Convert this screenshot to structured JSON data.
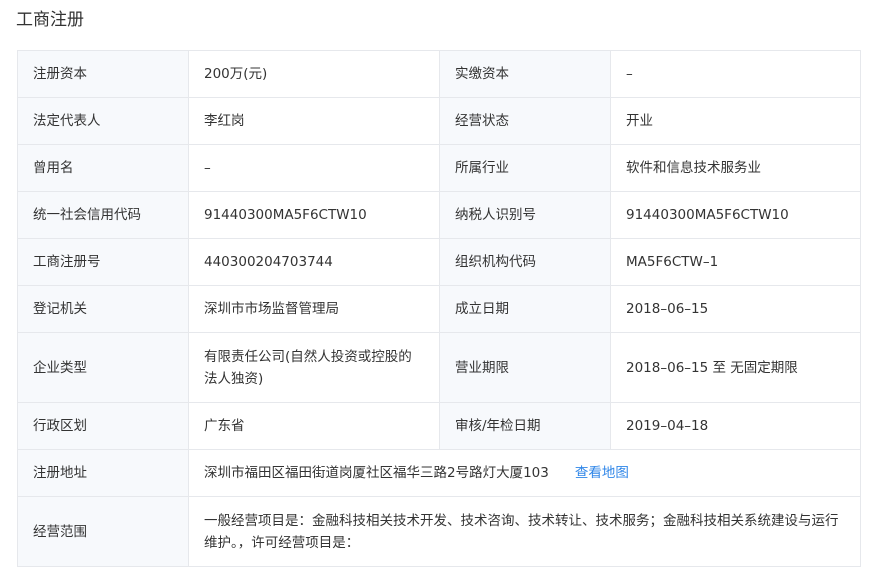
{
  "section": {
    "title": "工商注册"
  },
  "rows": [
    {
      "l1": "注册资本",
      "v1": "200万(元)",
      "l2": "实缴资本",
      "v2": "–"
    },
    {
      "l1": "法定代表人",
      "v1": "李红岗",
      "l2": "经营状态",
      "v2": "开业"
    },
    {
      "l1": "曾用名",
      "v1": "–",
      "l2": "所属行业",
      "v2": "软件和信息技术服务业"
    },
    {
      "l1": "统一社会信用代码",
      "v1": "91440300MA5F6CTW10",
      "l2": "纳税人识别号",
      "v2": "91440300MA5F6CTW10"
    },
    {
      "l1": "工商注册号",
      "v1": "440300204703744",
      "l2": "组织机构代码",
      "v2": "MA5F6CTW–1"
    },
    {
      "l1": "登记机关",
      "v1": "深圳市市场监督管理局",
      "l2": "成立日期",
      "v2": "2018–06–15"
    },
    {
      "l1": "企业类型",
      "v1": "有限责任公司(自然人投资或控股的法人独资)",
      "l2": "营业期限",
      "v2": "2018–06–15 至 无固定期限"
    },
    {
      "l1": "行政区划",
      "v1": "广东省",
      "l2": "审核/年检日期",
      "v2": "2019–04–18"
    }
  ],
  "address": {
    "label": "注册地址",
    "value": "深圳市福田区福田街道岗厦社区福华三路2号路灯大厦103",
    "link": "查看地图"
  },
  "scope": {
    "label": "经营范围",
    "value": "一般经营项目是：金融科技相关技术开发、技术咨询、技术转让、技术服务；金融科技相关系统建设与运行维护。，许可经营项目是："
  },
  "colors": {
    "label_bg": "#f7f9fc",
    "border": "#e6e8ec",
    "link": "#2f86e8",
    "text": "#333333"
  }
}
